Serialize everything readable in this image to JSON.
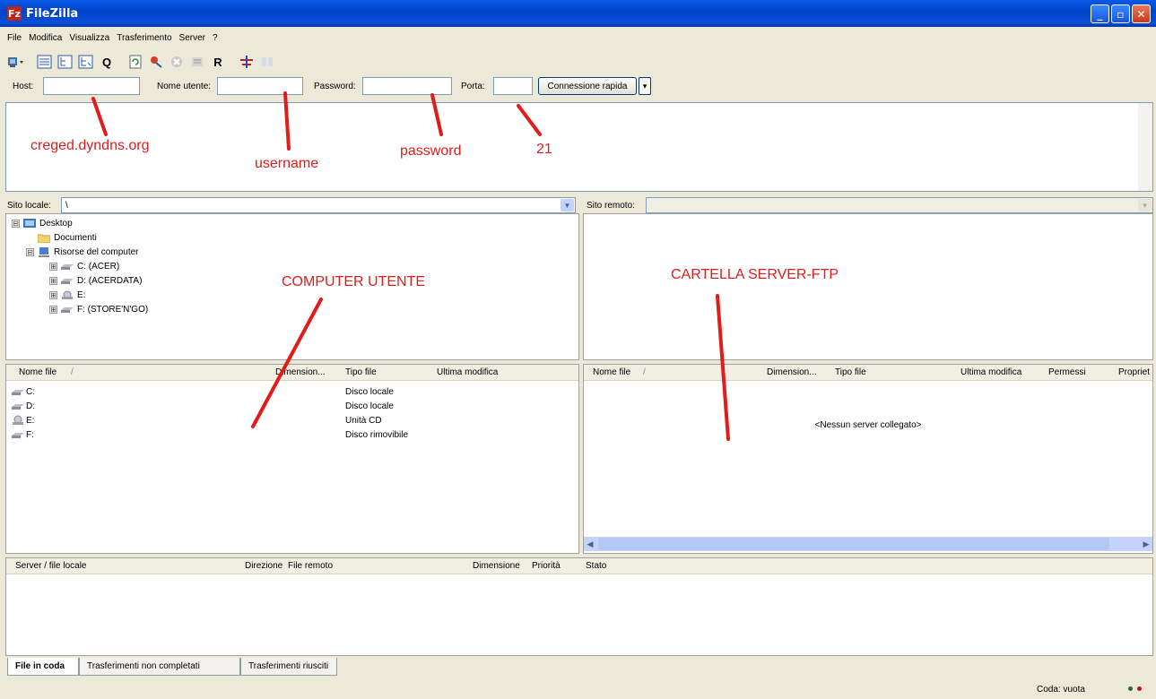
{
  "window": {
    "title": "FileZilla",
    "icon_letter": "Fz",
    "min": "_",
    "max": "▫",
    "close": "✕"
  },
  "menu": [
    "File",
    "Modifica",
    "Visualizza",
    "Trasferimento",
    "Server",
    "?"
  ],
  "toolbar": {
    "icons": [
      "site-manager-icon",
      "toggle-log-icon",
      "toggle-local-tree-icon",
      "toggle-remote-tree-icon",
      "queue-icon",
      "refresh-icon",
      "process-queue-icon",
      "cancel-icon",
      "disconnect-icon",
      "reconnect-icon",
      "filter-icon",
      "compare-icon"
    ],
    "q_label": "Q",
    "r_label": "R"
  },
  "quickconnect": {
    "host_label": "Host:",
    "host_value": "",
    "user_label": "Nome utente:",
    "user_value": "",
    "password_label": "Password:",
    "password_value": "",
    "port_label": "Porta:",
    "port_value": "",
    "connect_label": "Connessione rapida",
    "dropdown": "▾"
  },
  "local": {
    "site_label": "Sito locale:",
    "site_value": "\\",
    "tree": [
      {
        "toggle": "⊟",
        "label": "Desktop",
        "icon": "desktop-icon"
      },
      {
        "toggle": "",
        "label": "Documenti",
        "icon": "folder-icon"
      },
      {
        "toggle": "⊟",
        "label": "Risorse del computer",
        "icon": "computer-icon"
      },
      {
        "toggle": "⊞",
        "label": "C: (ACER)",
        "icon": "drive-icon"
      },
      {
        "toggle": "⊞",
        "label": "D: (ACERDATA)",
        "icon": "drive-icon"
      },
      {
        "toggle": "⊞",
        "label": "E:",
        "icon": "cd-icon"
      },
      {
        "toggle": "⊞",
        "label": "F: (STORE'N'GO)",
        "icon": "drive-icon"
      }
    ],
    "headers": {
      "name": "Nome file",
      "sort": "/",
      "size": "Dimension...",
      "type": "Tipo file",
      "modified": "Ultima modifica"
    },
    "files": [
      {
        "name": "C:",
        "type": "Disco locale"
      },
      {
        "name": "D:",
        "type": "Disco locale"
      },
      {
        "name": "E:",
        "type": "Unità CD"
      },
      {
        "name": "F:",
        "type": "Disco rimovibile"
      }
    ]
  },
  "remote": {
    "site_label": "Sito remoto:",
    "site_value": "",
    "headers": {
      "name": "Nome file",
      "sort": "/",
      "size": "Dimension...",
      "type": "Tipo file",
      "modified": "Ultima modifica",
      "perms": "Permessi",
      "owner": "Propriet"
    },
    "empty": "<Nessun server collegato>"
  },
  "queue": {
    "headers": {
      "server": "Server / file locale",
      "direction": "Direzione",
      "remote": "File remoto",
      "size": "Dimensione",
      "priority": "Priorità",
      "status": "Stato"
    }
  },
  "tabs": [
    "File in coda",
    "Trasferimenti non completati",
    "Trasferimenti riusciti"
  ],
  "statusbar": {
    "queue": "Coda: vuota"
  },
  "annotations": {
    "host": "creged.dyndns.org",
    "user": "username",
    "password": "password",
    "port": "21",
    "local": "COMPUTER UTENTE",
    "remote": "CARTELLA SERVER-FTP"
  },
  "colors": {
    "annotation": "#e21b1b",
    "titlebar": "#0a4fd8"
  }
}
